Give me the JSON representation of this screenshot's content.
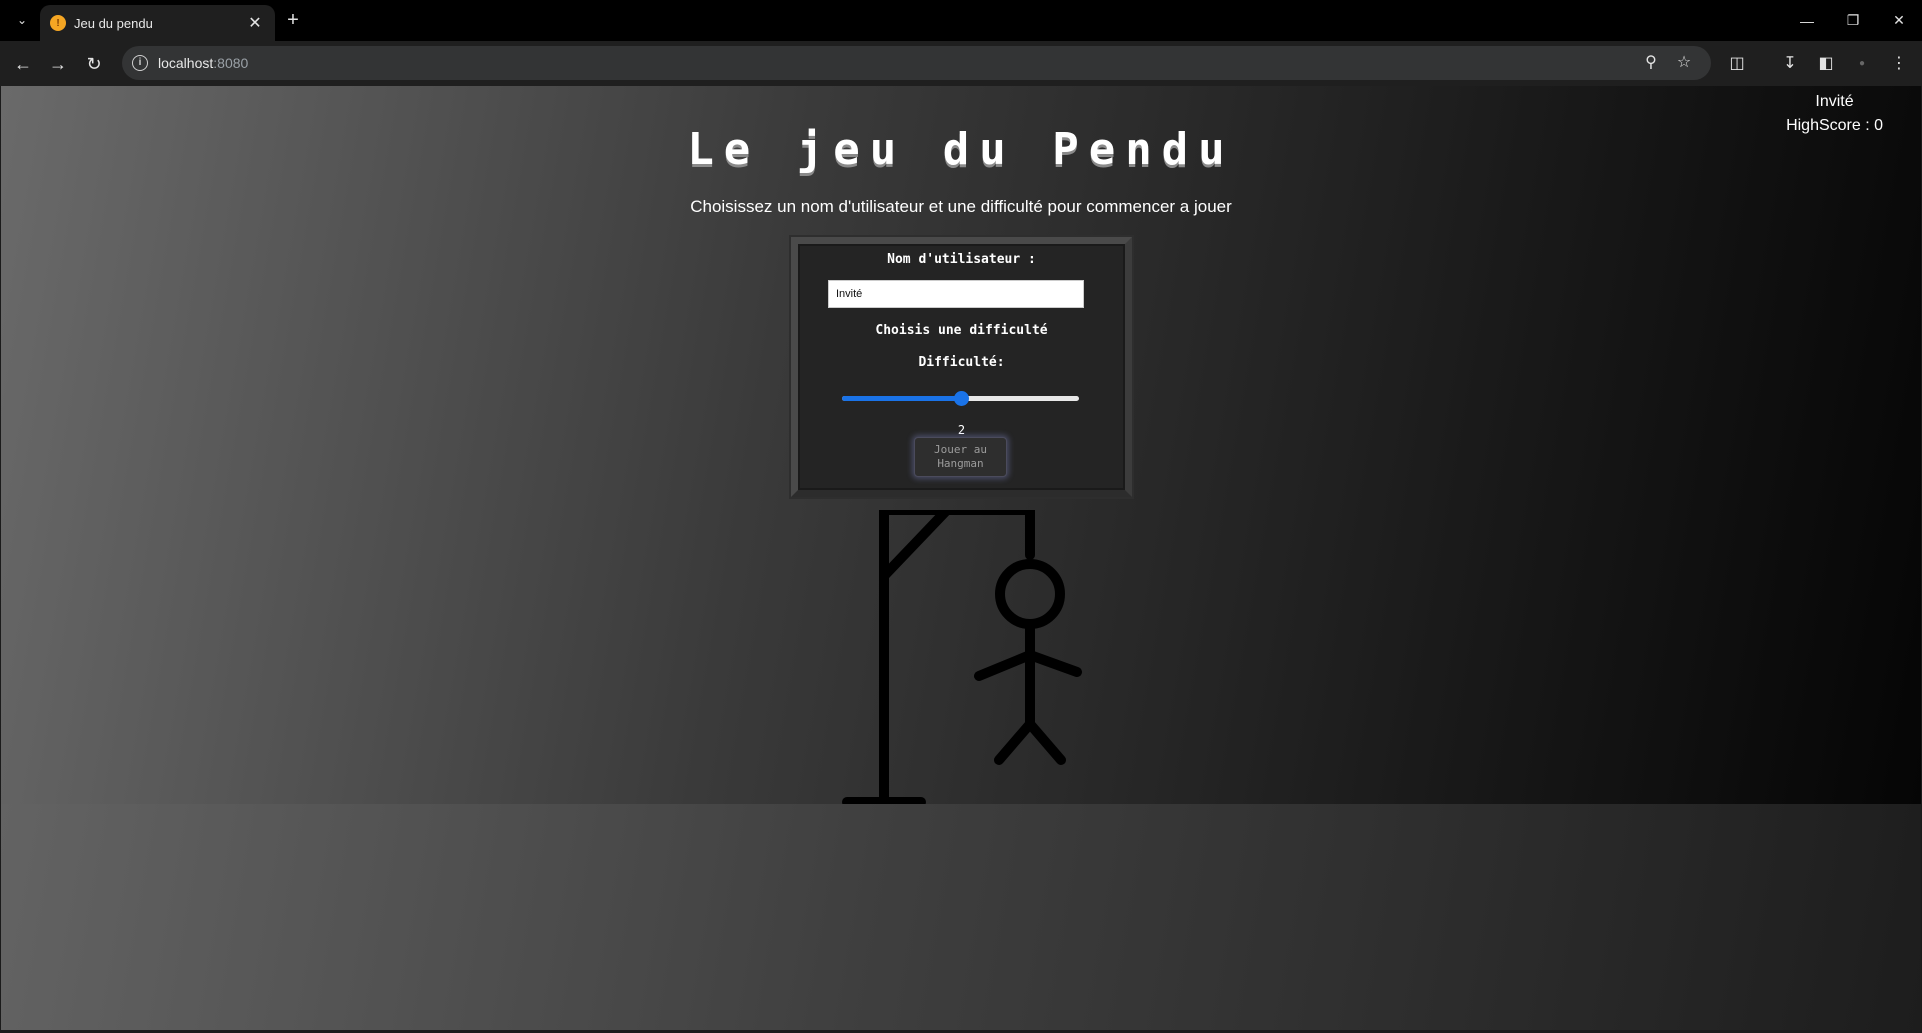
{
  "browser": {
    "tab_title": "Jeu du pendu",
    "tab_favicon_icon": "pendu-favicon",
    "url_host": "localhost",
    "url_port": ":8080"
  },
  "header": {
    "username": "Invité",
    "highscore": "HighScore : 0"
  },
  "main": {
    "title": "Le jeu du Pendu",
    "subtitle": "Choisissez un nom d'utilisateur et une difficulté pour commencer a jouer"
  },
  "form": {
    "username_label": "Nom d'utilisateur :",
    "username_value": "Invité",
    "difficulty_heading": "Choisis une difficulté",
    "difficulty_label": "Difficulté:",
    "difficulty_value": "2",
    "difficulty_min": 0,
    "difficulty_max": 4,
    "difficulty_level": 2,
    "play_button_label": "Jouer au\nHangman"
  },
  "colors": {
    "accent": "#1a73e8",
    "panel": "#242424",
    "text": "#ffffff"
  }
}
